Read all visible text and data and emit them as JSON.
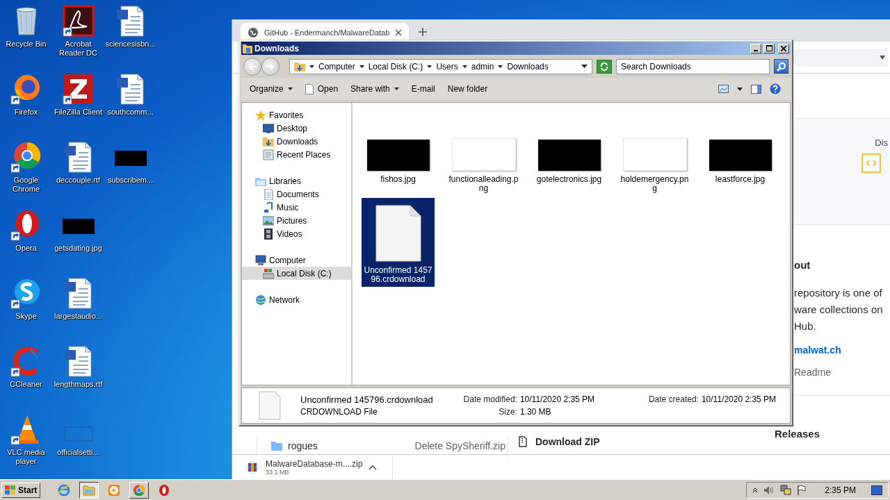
{
  "desktop": {
    "icons": [
      {
        "label": "Recycle Bin",
        "kind": "bin"
      },
      {
        "label": "Firefox",
        "kind": "firefox"
      },
      {
        "label": "Google Chrome",
        "kind": "chrome"
      },
      {
        "label": "Opera",
        "kind": "opera"
      },
      {
        "label": "Skype",
        "kind": "skype"
      },
      {
        "label": "CCleaner",
        "kind": "ccleaner"
      },
      {
        "label": "VLC media player",
        "kind": "vlc"
      },
      {
        "label": "Acrobat Reader DC",
        "kind": "acrobat"
      },
      {
        "label": "FileZilla Client",
        "kind": "filezilla"
      },
      {
        "label": "deccouple.rtf",
        "kind": "doc"
      },
      {
        "label": "getsdating.jpg",
        "kind": "image"
      },
      {
        "label": "largestaudio...",
        "kind": "doc"
      },
      {
        "label": "lengthmaps.rtf",
        "kind": "doc"
      },
      {
        "label": "officialsetti...",
        "kind": "blank"
      },
      {
        "label": "sciencesisbn...",
        "kind": "doc"
      },
      {
        "label": "southcomm...",
        "kind": "doc"
      },
      {
        "label": "subscribem...",
        "kind": "image"
      }
    ]
  },
  "browser": {
    "tab": {
      "title": "GitHub - Endermanch/MalwareDatab"
    },
    "sidebar": {
      "panel_label": "Dis",
      "about_heading": "out",
      "about_lines": [
        "repository is one of",
        "ware collections on",
        "Hub."
      ],
      "link": "malwat.ch",
      "readme": "Readme",
      "releases": "Releases"
    },
    "file_row": {
      "name": "rogues",
      "commit": "Delete SpySheriff.zip"
    },
    "download_zip": "Download ZIP",
    "download_bar": {
      "file": "MalwareDatabase-m....zip",
      "size": "33.1 MB"
    }
  },
  "explorer": {
    "title": "Downloads",
    "breadcrumb": [
      "Computer",
      "Local Disk (C:)",
      "Users",
      "admin",
      "Downloads"
    ],
    "search": {
      "placeholder": "Search Downloads"
    },
    "toolbar": [
      {
        "label": "Organize",
        "kind": "menu"
      },
      {
        "label": "Open",
        "kind": "file"
      },
      {
        "label": "Share with",
        "kind": "menu"
      },
      {
        "label": "E-mail",
        "kind": "plain"
      },
      {
        "label": "New folder",
        "kind": "plain"
      }
    ],
    "nav": [
      {
        "label": "Favorites",
        "kind": "star",
        "selected": false,
        "children": [
          {
            "label": "Desktop",
            "kind": "desktop",
            "selected": false
          },
          {
            "label": "Downloads",
            "kind": "downloads",
            "selected": false
          },
          {
            "label": "Recent Places",
            "kind": "recent",
            "selected": false
          }
        ]
      },
      {
        "label": "Libraries",
        "kind": "libraries",
        "selected": false,
        "children": [
          {
            "label": "Documents",
            "kind": "documents",
            "selected": false
          },
          {
            "label": "Music",
            "kind": "music",
            "selected": false
          },
          {
            "label": "Pictures",
            "kind": "pictures",
            "selected": false
          },
          {
            "label": "Videos",
            "kind": "videos",
            "selected": false
          }
        ]
      },
      {
        "label": "Computer",
        "kind": "computer",
        "selected": false,
        "children": [
          {
            "label": "Local Disk (C:)",
            "kind": "disk",
            "selected": true
          }
        ]
      },
      {
        "label": "Network",
        "kind": "network",
        "selected": false
      }
    ],
    "files": [
      {
        "name": "fishos.jpg",
        "kind": "dark",
        "selected": false
      },
      {
        "name": "functionalleading.png",
        "kind": "light",
        "selected": false
      },
      {
        "name": "gotelectronics.jpg",
        "kind": "dark",
        "selected": false
      },
      {
        "name": "holdemergency.png",
        "kind": "light",
        "selected": false
      },
      {
        "name": "leastforce.jpg",
        "kind": "dark",
        "selected": false
      },
      {
        "name": "Unconfirmed 145796.crdownload",
        "kind": "file",
        "selected": true
      }
    ],
    "details": {
      "name": "Unconfirmed 145796.crdownload",
      "type": "CRDOWNLOAD File",
      "modified_label": "Date modified:",
      "modified": "10/11/2020 2:35 PM",
      "size_label": "Size:",
      "size": "1.30 MB",
      "created_label": "Date created:",
      "created": "10/11/2020 2:35 PM"
    }
  },
  "taskbar": {
    "start": "Start",
    "apps": [
      {
        "kind": "ie",
        "open": false,
        "selected": false
      },
      {
        "kind": "explorer",
        "open": true,
        "selected": true
      },
      {
        "kind": "media",
        "open": false,
        "selected": false
      },
      {
        "kind": "chrome",
        "open": true,
        "selected": false
      },
      {
        "kind": "opera",
        "open": false,
        "selected": false
      }
    ],
    "clock": "2:35 PM"
  }
}
